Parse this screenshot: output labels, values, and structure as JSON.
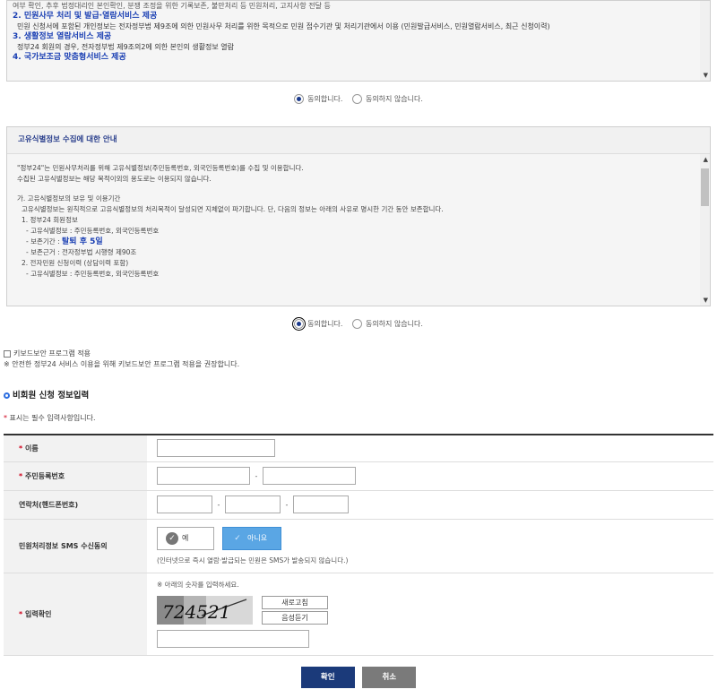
{
  "notice1": {
    "line0": "여부 확인, 추후 법정대리인 본인확인, 분쟁 조정을 위한 기록보존, 불만처리 등 민원처리, 고지사항 전달 등",
    "h2": "2. 민원사무 처리 및 발급·열람서비스 제공",
    "p2": "민원 신청서에 포함된 개인정보는 전자정부법 제9조에 의한 민원사무 처리를 위한 목적으로 민원 접수기관 및 처리기관에서 이용 (민원발급서비스, 민원열람서비스, 최근 신청이력)",
    "h3": "3. 생활정보 열람서비스 제공",
    "p3": "정부24 회원의 경우, 전자정부법 제9조의2에 의한 본인의 생활정보 열람",
    "h4": "4. 국가보조금 맞춤형서비스 제공"
  },
  "consent1": {
    "agree": "동의합니다.",
    "disagree": "동의하지 않습니다."
  },
  "notice2": {
    "title": "고유식별정보 수집에 대한 안내",
    "l1": "\"정부24\"는 민원사무처리를 위해 고유식별정보(주민등록번호, 외국인등록번호)를 수집 및 이용합니다.",
    "l2": "수집된 고유식별정보는 해당 목적이외의 용도로는 이용되지 않습니다.",
    "l3": "가. 고유식별정보의 보유 및 이용기간",
    "l4": "고유식별정보는 원칙적으로 고유식별정보의 처리목적이 달성되면 지체없이 파기합니다. 단, 다음의 정보는 아래의 사유로 명시한 기간 동안 보존합니다.",
    "l5": "1. 정부24 회원정보",
    "l6": "- 고유식별정보 : 주민등록번호, 외국인등록번호",
    "l7a": "- 보존기간 : ",
    "l7b": "탈퇴 후 5일",
    "l8": "- 보존근거 : 전자정부법 시행령 제90조",
    "l9": "2. 전자민원 신청이력 (상담이력 포함)",
    "l10": "- 고유식별정보 : 주민등록번호, 외국인등록번호"
  },
  "consent2": {
    "agree": "동의합니다.",
    "disagree": "동의하지 않습니다."
  },
  "keyboard": {
    "checkbox_label": "키보드보안 프로그램 적용",
    "note": "※ 안전한 정부24 서비스 이용을 위해 키보드보안 프로그램 적용을 권장합니다."
  },
  "section_title": "비회원 신청 정보입력",
  "required_note": "표시는 필수 입력사항입니다.",
  "required_mark": "*",
  "form": {
    "name_label": "이름",
    "rrn_label": "주민등록번호",
    "phone_label": "연락처(핸드폰번호)",
    "sms_label": "민원처리정보 SMS 수신동의",
    "sms_yes": "예",
    "sms_no": "아니요",
    "sms_note": "(인터넷으로 즉시 열람·발급되는 민원은 SMS가 발송되지 않습니다.)",
    "captcha_label": "입력확인",
    "captcha_note": "※ 아래의 숫자를 입력하세요.",
    "captcha_text": "724521",
    "refresh": "새로고침",
    "audio": "음성듣기",
    "dash": "-"
  },
  "buttons": {
    "ok": "확인",
    "cancel": "취소"
  }
}
